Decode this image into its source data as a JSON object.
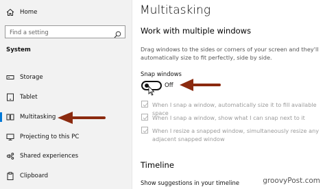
{
  "sidebar": {
    "home_label": "Home",
    "search_placeholder": "Find a setting",
    "section_label": "System",
    "items": [
      {
        "label": "Storage"
      },
      {
        "label": "Tablet"
      },
      {
        "label": "Multitasking"
      },
      {
        "label": "Projecting to this PC"
      },
      {
        "label": "Shared experiences"
      },
      {
        "label": "Clipboard"
      }
    ],
    "active_item": "Multitasking"
  },
  "main": {
    "title": "Multitasking",
    "section_title": "Work with multiple windows",
    "section_description": "Drag windows to the sides or corners of your screen and they'll automatically size to fit perfectly, side by side.",
    "snap_windows_label": "Snap windows",
    "snap_windows_state": "Off",
    "snap_windows_enabled": false,
    "options": [
      {
        "label": "When I snap a window, automatically size it to fill available space",
        "checked": true,
        "disabled": true
      },
      {
        "label": "When I snap a window, show what I can snap next to it",
        "checked": true,
        "disabled": true
      },
      {
        "label": "When I resize a snapped window, simultaneously resize any adjacent snapped window",
        "checked": true,
        "disabled": true
      }
    ],
    "timeline_title": "Timeline",
    "timeline_setting_label": "Show suggestions in your timeline"
  },
  "watermark": "groovyPost.com",
  "colors": {
    "sidebar_background": "#f2f2f2",
    "accent": "#0078d7",
    "annotation_arrow": "#8b2a0f",
    "disabled_text": "#9a9a9a"
  },
  "icons": [
    "home-icon",
    "search-icon",
    "storage-icon",
    "tablet-icon",
    "multitasking-icon",
    "projecting-icon",
    "shared-experiences-icon",
    "clipboard-icon",
    "checkmark-icon",
    "mouse-cursor-icon"
  ]
}
